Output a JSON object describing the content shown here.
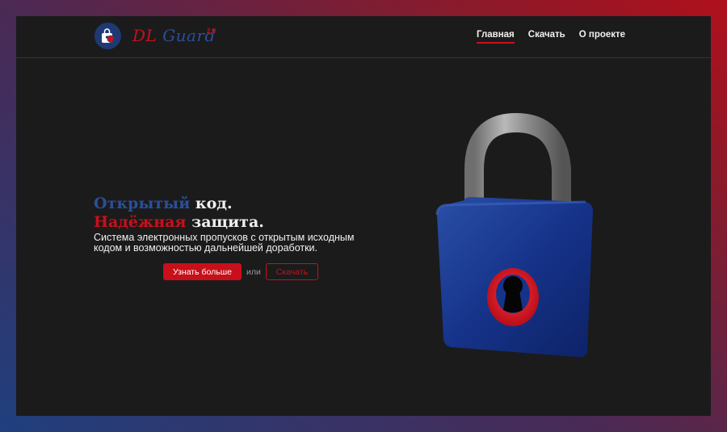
{
  "header": {
    "logo": {
      "brand_first": "DL",
      "brand_second": "Guard",
      "version": "2.0"
    },
    "nav": [
      {
        "label": "Главная",
        "active": true
      },
      {
        "label": "Скачать",
        "active": false
      },
      {
        "label": "О проекте",
        "active": false
      }
    ]
  },
  "hero": {
    "line1_highlight": "Открытый",
    "line1_rest": " код.",
    "line2_highlight": "Надёжная",
    "line2_rest": " защита.",
    "subtitle": "Система электронных пропусков с открытым исходным кодом и возможностью дальнейшей доработки.",
    "primary_button": "Узнать больше",
    "or_text": "или",
    "secondary_button": "Скачать",
    "illustration": "padlock-illustration"
  },
  "colors": {
    "accent_red": "#c8101a",
    "accent_blue": "#2a4f9a",
    "background": "#1b1b1c",
    "text": "#f1f1f1"
  },
  "icons": [
    "shield-bag-icon",
    "padlock-illustration"
  ]
}
